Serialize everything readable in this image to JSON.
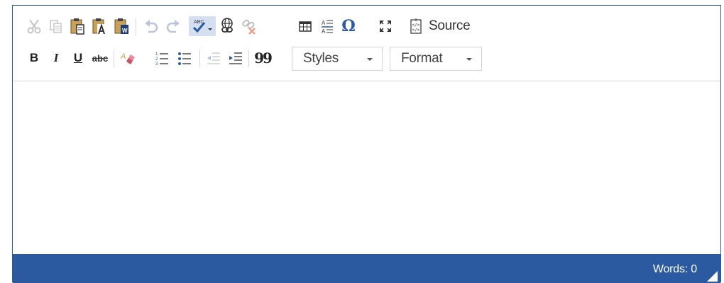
{
  "editor": {
    "toolbar": {
      "row1": {
        "icons": [
          "cut-icon",
          "copy-icon",
          "paste-icon",
          "paste-text-icon",
          "paste-from-word-icon",
          "undo-icon",
          "redo-icon",
          "spellcheck-icon",
          "link-icon",
          "unlink-icon",
          "table-icon",
          "horizontal-rule-icon",
          "special-character-icon",
          "maximize-icon",
          "source-icon"
        ],
        "spellcheck_label": "ABC",
        "special_char_label": "Ω",
        "source_label": "Source"
      },
      "row2": {
        "bold_label": "B",
        "italic_label": "I",
        "underline_label": "U",
        "strike_label": "abc",
        "icons": [
          "remove-format-icon",
          "numbered-list-icon",
          "bulleted-list-icon",
          "outdent-icon",
          "indent-icon",
          "blockquote-icon"
        ],
        "blockquote_label": "99",
        "styles_value": "Styles",
        "format_value": "Format"
      }
    },
    "content": {
      "text": ""
    },
    "statusbar": {
      "words_label": "Words: 0"
    },
    "colors": {
      "accent": "#2c5aa0",
      "icon_gray": "#bbbbbb",
      "icon_dark": "#333333",
      "spell_bg": "#d4e0f2"
    }
  }
}
